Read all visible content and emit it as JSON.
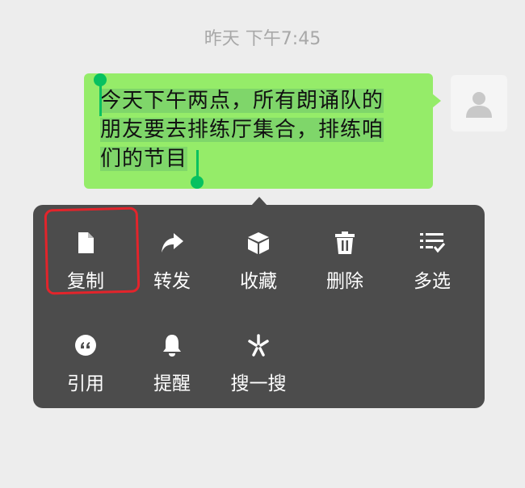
{
  "chat": {
    "timestamp": "昨天 下午7:45",
    "message": {
      "line1": "今天下午两点，所有朗诵队的",
      "line2": "朋友要去排练厅集合，排练咱",
      "line3": "们的节目"
    }
  },
  "menu": {
    "items": [
      {
        "label": "复制",
        "icon": "copy-icon"
      },
      {
        "label": "转发",
        "icon": "forward-icon"
      },
      {
        "label": "收藏",
        "icon": "favorite-icon"
      },
      {
        "label": "删除",
        "icon": "delete-icon"
      },
      {
        "label": "多选",
        "icon": "multi-select-icon"
      },
      {
        "label": "引用",
        "icon": "quote-icon"
      },
      {
        "label": "提醒",
        "icon": "bell-icon"
      },
      {
        "label": "搜一搜",
        "icon": "search-spark-icon"
      }
    ]
  },
  "colors": {
    "bubble": "#95ec69",
    "selection_handle": "#07c160",
    "menu_background": "#4c4c4c",
    "annotation": "#e3242b"
  }
}
